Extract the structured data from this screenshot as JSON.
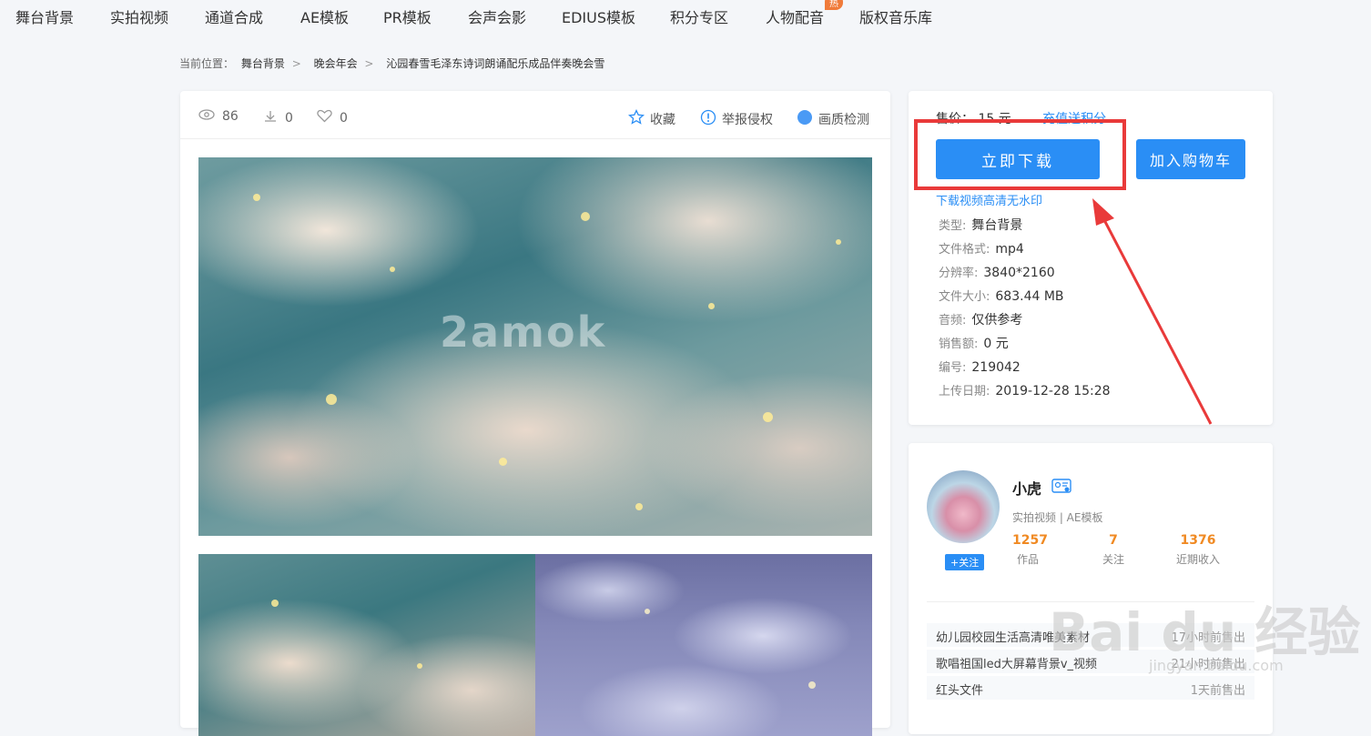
{
  "nav": {
    "items": [
      "舞台背景",
      "实拍视频",
      "通道合成",
      "AE模板",
      "PR模板",
      "会声会影",
      "EDIUS模板",
      "积分专区",
      "人物配音",
      "版权音乐库"
    ],
    "hot_badge": "热"
  },
  "breadcrumb": {
    "label": "当前位置：",
    "items": [
      "舞台背景",
      "晚会年会",
      "沁园春雪毛泽东诗词朗诵配乐成品伴奏晚会雪"
    ],
    "separator": ">"
  },
  "stats": {
    "views": "86",
    "downloads": "0",
    "likes": "0"
  },
  "actions": {
    "favorite": "收藏",
    "report": "举报侵权",
    "quality": "画质检测"
  },
  "preview": {
    "watermark": "2amok"
  },
  "purchase": {
    "price_label": "售价：",
    "price_value": "15 元",
    "price_link": "充值送积分",
    "download_button": "立即下载",
    "cart_button": "加入购物车",
    "hd_link": "下载视频高清无水印"
  },
  "info": [
    {
      "label": "类型:",
      "value": "舞台背景"
    },
    {
      "label": "文件格式:",
      "value": "mp4"
    },
    {
      "label": "分辨率:",
      "value": "3840*2160"
    },
    {
      "label": "文件大小:",
      "value": "683.44 MB"
    },
    {
      "label": "音频:",
      "value": "仅供参考"
    },
    {
      "label": "销售额:",
      "value": "0 元"
    },
    {
      "label": "编号:",
      "value": "219042"
    },
    {
      "label": "上传日期:",
      "value": "2019-12-28 15:28"
    }
  ],
  "author": {
    "name": "小虎",
    "categories": "实拍视频 | AE模板",
    "follow": "+关注",
    "stats": [
      {
        "num": "1257",
        "label": "作品"
      },
      {
        "num": "7",
        "label": "关注"
      },
      {
        "num": "1376",
        "label": "近期收入"
      }
    ]
  },
  "sales": [
    {
      "title": "幼儿园校园生活高清唯美素材",
      "time": "17小时前售出"
    },
    {
      "title": "歌唱祖国led大屏幕背景v_视频",
      "time": "21小时前售出"
    },
    {
      "title": "红头文件",
      "time": "1天前售出"
    }
  ],
  "overlay": {
    "baidu": "Bai du 经验",
    "baidu_sub": "jingyan.baidu.com"
  },
  "colors": {
    "accent": "#2a8ef5",
    "highlight": "#e93a3a",
    "stat": "#f08a23"
  }
}
